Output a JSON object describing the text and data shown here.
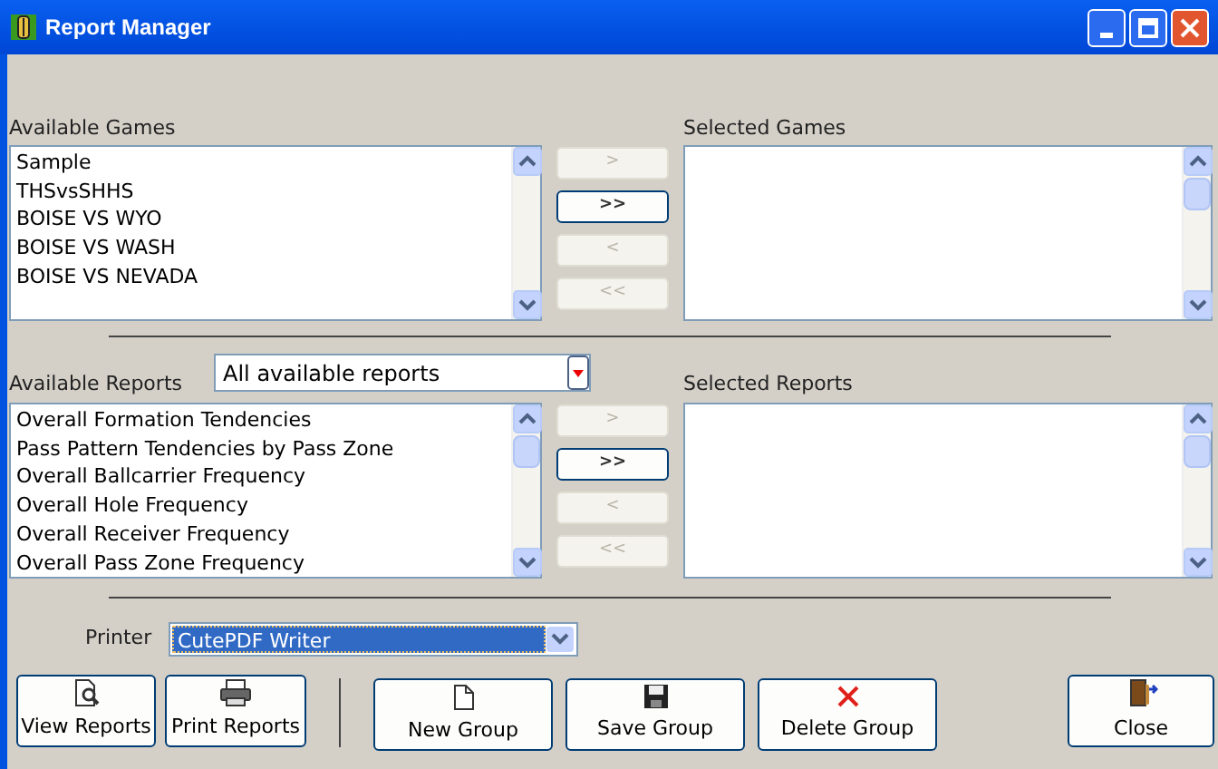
{
  "window": {
    "title": "Report Manager"
  },
  "games": {
    "available_label": "Available Games",
    "selected_label": "Selected Games",
    "available": [
      "Sample",
      "THSvsSHHS",
      "BOISE VS WYO",
      "BOISE VS WASH",
      "BOISE VS NEVADA"
    ],
    "transfer_buttons": [
      {
        "label": ">",
        "disabled": true
      },
      {
        "label": ">>",
        "disabled": false
      },
      {
        "label": "<",
        "disabled": true
      },
      {
        "label": "<<",
        "disabled": true
      }
    ]
  },
  "reports": {
    "available_label": "Available Reports",
    "filter": {
      "value": "All available reports"
    },
    "selected_label": "Selected Reports",
    "available": [
      "Overall Formation Tendencies",
      "Pass Pattern Tendencies by Pass Zone",
      "Overall Ballcarrier Frequency",
      "Overall Hole Frequency",
      "Overall Receiver Frequency",
      "Overall Pass Zone Frequency"
    ],
    "transfer_buttons": [
      {
        "label": ">",
        "disabled": true
      },
      {
        "label": ">>",
        "disabled": false
      },
      {
        "label": "<",
        "disabled": true
      },
      {
        "label": "<<",
        "disabled": true
      }
    ]
  },
  "printer": {
    "label": "Printer",
    "value": "CutePDF Writer"
  },
  "buttons": [
    {
      "kind": "view",
      "label": "View Reports"
    },
    {
      "kind": "print",
      "label": "Print Reports"
    },
    {
      "kind": "new",
      "label": "New Group"
    },
    {
      "kind": "save",
      "label": "Save Group"
    },
    {
      "kind": "delete",
      "label": "Delete Group"
    },
    {
      "kind": "close",
      "label": "Close"
    }
  ]
}
